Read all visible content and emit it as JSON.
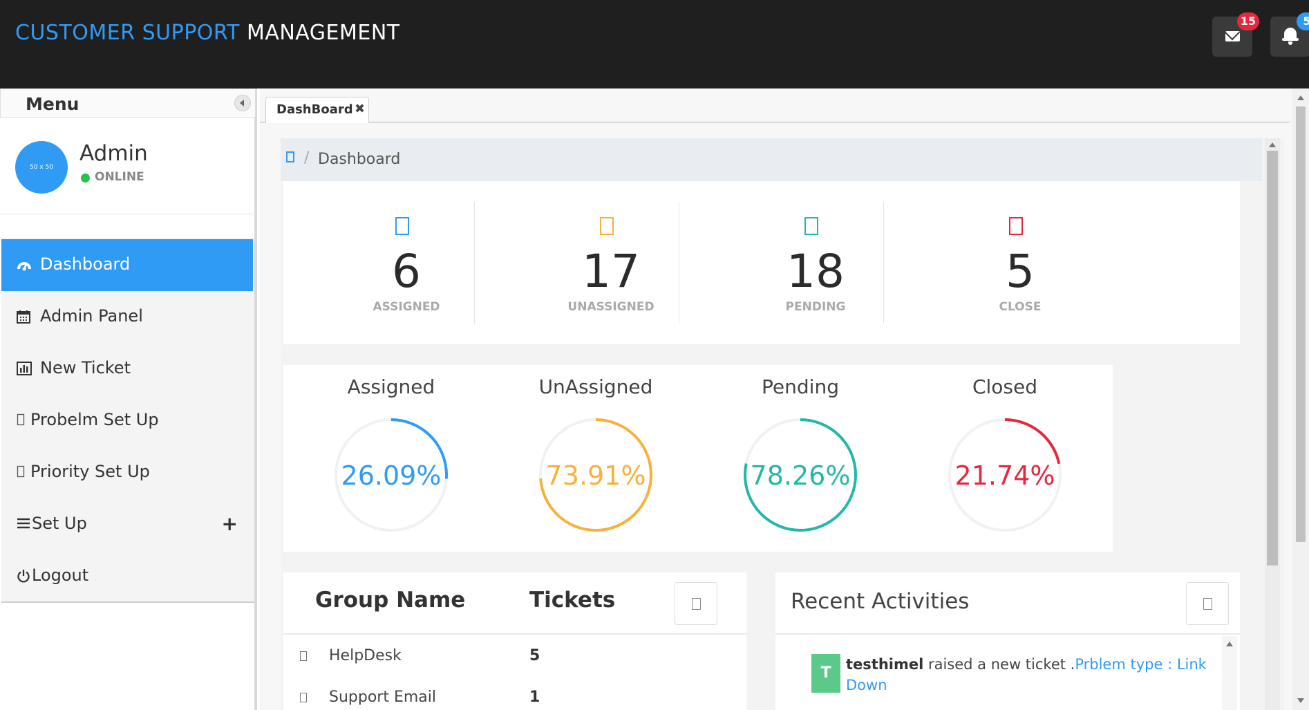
{
  "header": {
    "brand_part1": "CUSTOMER SUPPORT",
    "brand_part2": "MANAGEMENT",
    "mail_badge": "15",
    "bell_badge": "5",
    "mail_icon": "envelope-icon",
    "bell_icon": "bell-icon"
  },
  "sidebar": {
    "menu_title": "Menu",
    "profile": {
      "avatar_placeholder": "50 x 50",
      "name": "Admin",
      "status": "ONLINE"
    },
    "items": [
      {
        "label": "Dashboard",
        "icon": "dashboard-icon",
        "active": true
      },
      {
        "label": "Admin Panel",
        "icon": "calendar-icon"
      },
      {
        "label": "New Ticket",
        "icon": "bar-chart-icon"
      },
      {
        "label": "Probelm Set Up",
        "icon": "missing-glyph-icon"
      },
      {
        "label": "Priority Set Up",
        "icon": "missing-glyph-icon"
      },
      {
        "label": "Set Up",
        "icon": "list-icon",
        "expand_icon": "plus-icon"
      },
      {
        "label": "Logout",
        "icon": "power-icon"
      }
    ]
  },
  "tabs": [
    {
      "label": "DashBoard",
      "close": "✖"
    }
  ],
  "breadcrumb": {
    "home_icon": "home-icon",
    "separator": "/",
    "current": "Dashboard"
  },
  "stats": [
    {
      "value": "6",
      "label": "ASSIGNED",
      "color": "#2f9bf4"
    },
    {
      "value": "17",
      "label": "UNASSIGNED",
      "color": "#f8b13c"
    },
    {
      "value": "18",
      "label": "PENDING",
      "color": "#22b8a8"
    },
    {
      "value": "5",
      "label": "CLOSE",
      "color": "#e8263d"
    }
  ],
  "gauges": [
    {
      "title": "Assigned",
      "value_text": "26.09%",
      "percent": 26.09,
      "color": "#2f9bf4"
    },
    {
      "title": "UnAssigned",
      "value_text": "73.91%",
      "percent": 73.91,
      "color": "#f8b13c"
    },
    {
      "title": "Pending",
      "value_text": "78.26%",
      "percent": 78.26,
      "color": "#22b8a8"
    },
    {
      "title": "Closed",
      "value_text": "21.74%",
      "percent": 21.74,
      "color": "#e8263d"
    }
  ],
  "groups": {
    "header_name": "Group Name",
    "header_tickets": "Tickets",
    "rows": [
      {
        "name": "HelpDesk",
        "tickets": "5"
      },
      {
        "name": "Support Email",
        "tickets": "1"
      }
    ]
  },
  "activities": {
    "title": "Recent Activities",
    "items": [
      {
        "avatar": "T",
        "user": "testhimel",
        "text": " raised a new ticket .",
        "link": "Prblem type : Link Down"
      }
    ]
  }
}
